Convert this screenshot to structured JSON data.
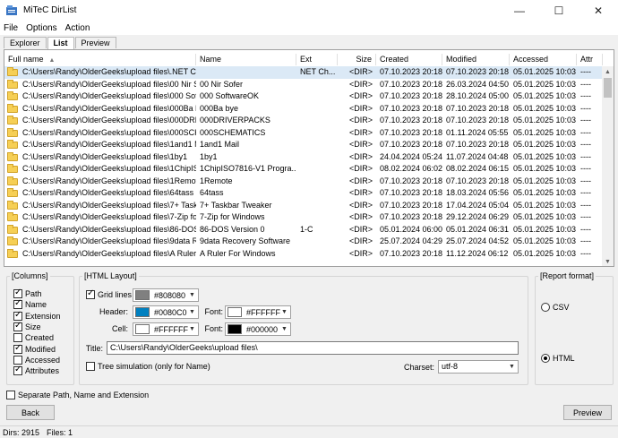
{
  "window": {
    "title": "MiTeC DirList"
  },
  "menu": [
    "File",
    "Options",
    "Action"
  ],
  "tabs": [
    {
      "label": "Explorer",
      "active": false
    },
    {
      "label": "List",
      "active": true
    },
    {
      "label": "Preview",
      "active": false
    }
  ],
  "list": {
    "columns": [
      "Full name",
      "Name",
      "Ext",
      "Size",
      "Created",
      "Modified",
      "Accessed",
      "Attr"
    ],
    "rows": [
      [
        "C:\\Users\\Randy\\OlderGeeks\\upload files\\.NET Ch...",
        "",
        "NET Ch...",
        "<DIR>",
        "07.10.2023 20:18",
        "07.10.2023 20:18",
        "05.01.2025 10:03",
        "----"
      ],
      [
        "C:\\Users\\Randy\\OlderGeeks\\upload files\\00 Nir S...",
        "00 Nir Sofer",
        "",
        "<DIR>",
        "07.10.2023 20:18",
        "26.03.2024 04:50",
        "05.01.2025 10:03",
        "----"
      ],
      [
        "C:\\Users\\Randy\\OlderGeeks\\upload files\\000 Soft...",
        "000 SoftwareOK",
        "",
        "<DIR>",
        "07.10.2023 20:18",
        "28.10.2024 05:00",
        "05.01.2025 10:03",
        "----"
      ],
      [
        "C:\\Users\\Randy\\OlderGeeks\\upload files\\000Ba bye",
        "000Ba bye",
        "",
        "<DIR>",
        "07.10.2023 20:18",
        "07.10.2023 20:18",
        "05.01.2025 10:03",
        "----"
      ],
      [
        "C:\\Users\\Randy\\OlderGeeks\\upload files\\000DRIV...",
        "000DRIVERPACKS",
        "",
        "<DIR>",
        "07.10.2023 20:18",
        "07.10.2023 20:18",
        "05.01.2025 10:03",
        "----"
      ],
      [
        "C:\\Users\\Randy\\OlderGeeks\\upload files\\000SCH...",
        "000SCHEMATICS",
        "",
        "<DIR>",
        "07.10.2023 20:18",
        "01.11.2024 05:55",
        "05.01.2025 10:03",
        "----"
      ],
      [
        "C:\\Users\\Randy\\OlderGeeks\\upload files\\1and1 Mail",
        "1and1 Mail",
        "",
        "<DIR>",
        "07.10.2023 20:18",
        "07.10.2023 20:18",
        "05.01.2025 10:03",
        "----"
      ],
      [
        "C:\\Users\\Randy\\OlderGeeks\\upload files\\1by1",
        "1by1",
        "",
        "<DIR>",
        "24.04.2024 05:24",
        "11.07.2024 04:48",
        "05.01.2025 10:03",
        "----"
      ],
      [
        "C:\\Users\\Randy\\OlderGeeks\\upload files\\1ChipIS...",
        "1ChipISO7816-V1 Progra...",
        "",
        "<DIR>",
        "08.02.2024 06:02",
        "08.02.2024 06:15",
        "05.01.2025 10:03",
        "----"
      ],
      [
        "C:\\Users\\Randy\\OlderGeeks\\upload files\\1Remote",
        "1Remote",
        "",
        "<DIR>",
        "07.10.2023 20:18",
        "07.10.2023 20:18",
        "05.01.2025 10:03",
        "----"
      ],
      [
        "C:\\Users\\Randy\\OlderGeeks\\upload files\\64tass",
        "64tass",
        "",
        "<DIR>",
        "07.10.2023 20:18",
        "18.03.2024 05:56",
        "05.01.2025 10:03",
        "----"
      ],
      [
        "C:\\Users\\Randy\\OlderGeeks\\upload files\\7+ Task...",
        "7+ Taskbar Tweaker",
        "",
        "<DIR>",
        "07.10.2023 20:18",
        "17.04.2024 05:04",
        "05.01.2025 10:03",
        "----"
      ],
      [
        "C:\\Users\\Randy\\OlderGeeks\\upload files\\7-Zip for ...",
        "7-Zip for Windows",
        "",
        "<DIR>",
        "07.10.2023 20:18",
        "29.12.2024 06:29",
        "05.01.2025 10:03",
        "----"
      ],
      [
        "C:\\Users\\Randy\\OlderGeeks\\upload files\\86-DOS ...",
        "86-DOS Version 0",
        "1-C",
        "<DIR>",
        "05.01.2024 06:00",
        "05.01.2024 06:31",
        "05.01.2025 10:03",
        "----"
      ],
      [
        "C:\\Users\\Randy\\OlderGeeks\\upload files\\9data R...",
        "9data Recovery Software",
        "",
        "<DIR>",
        "25.07.2024 04:29",
        "25.07.2024 04:52",
        "05.01.2025 10:03",
        "----"
      ],
      [
        "C:\\Users\\Randy\\OlderGeeks\\upload files\\A Ruler ...",
        "A Ruler For Windows",
        "",
        "<DIR>",
        "07.10.2023 20:18",
        "11.12.2024 06:12",
        "05.01.2025 10:03",
        "----"
      ]
    ]
  },
  "columns_group": {
    "title": "[Columns]",
    "items": [
      {
        "label": "Path",
        "checked": true
      },
      {
        "label": "Name",
        "checked": true
      },
      {
        "label": "Extension",
        "checked": true
      },
      {
        "label": "Size",
        "checked": true
      },
      {
        "label": "Created",
        "checked": false
      },
      {
        "label": "Modified",
        "checked": true
      },
      {
        "label": "Accessed",
        "checked": false
      },
      {
        "label": "Attributes",
        "checked": true
      }
    ]
  },
  "html_layout": {
    "title": "[HTML Layout]",
    "grid_lines": {
      "label": "Grid lines",
      "checked": true,
      "color": "#808080",
      "color_text": "#808080"
    },
    "header": {
      "label": "Header:",
      "color": "#0080C0",
      "color_text": "#0080C0"
    },
    "header_font": {
      "label": "Font:",
      "color": "#FFFFFF",
      "color_text": "#FFFFFF"
    },
    "cell": {
      "label": "Cell:",
      "color": "#FFFFFF",
      "color_text": "#FFFFFF"
    },
    "cell_font": {
      "label": "Font:",
      "color": "#000000",
      "color_text": "#000000"
    },
    "title_label": "Title:",
    "title_value": "C:\\Users\\Randy\\OlderGeeks\\upload files\\",
    "tree_sim": {
      "label": "Tree simulation (only for Name)",
      "checked": false
    },
    "charset_label": "Charset:",
    "charset_value": "utf-8"
  },
  "report_format": {
    "title": "[Report format]",
    "csv": {
      "label": "CSV",
      "checked": false
    },
    "html": {
      "label": "HTML",
      "checked": true
    }
  },
  "separate": {
    "label": "Separate Path, Name and Extension",
    "checked": false
  },
  "buttons": {
    "back": "Back",
    "preview": "Preview"
  },
  "status": {
    "dirs": "Dirs: 2915",
    "files": "Files: 1"
  }
}
